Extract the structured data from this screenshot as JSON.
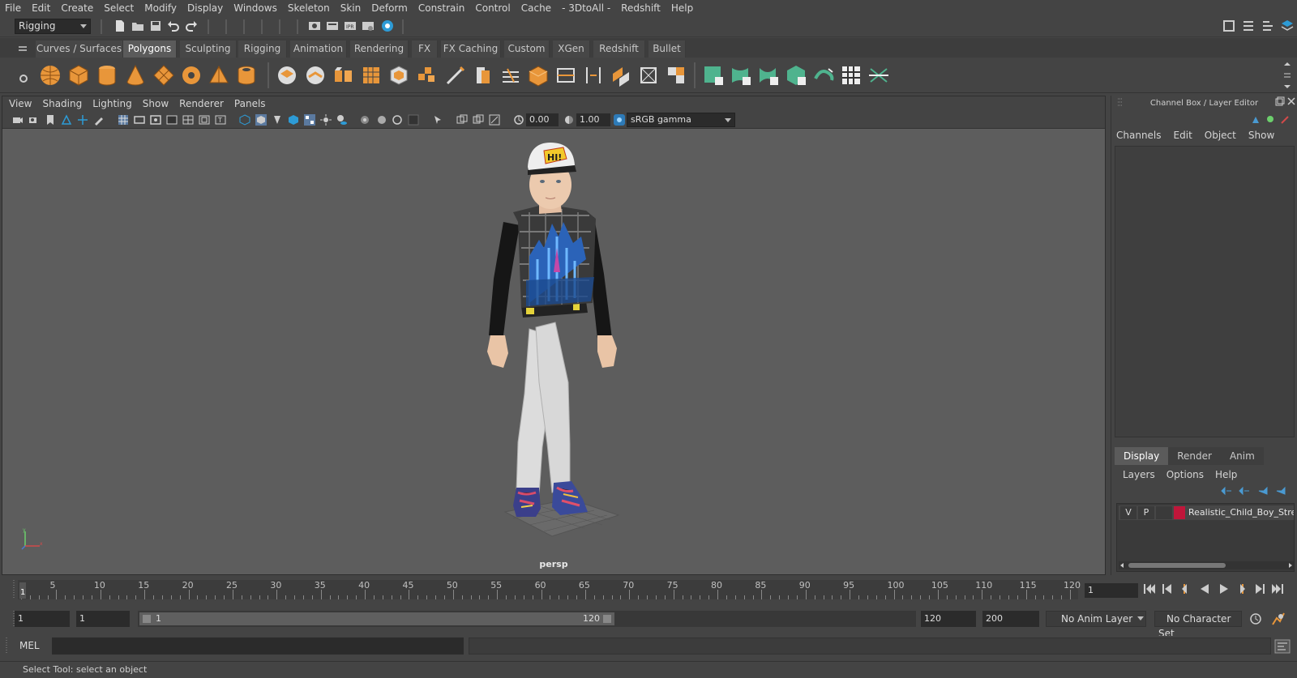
{
  "menubar": [
    "File",
    "Edit",
    "Create",
    "Select",
    "Modify",
    "Display",
    "Windows",
    "Skeleton",
    "Skin",
    "Deform",
    "Constrain",
    "Control",
    "Cache",
    "- 3DtoAll -",
    "Redshift",
    "Help"
  ],
  "status_line": {
    "mode": "Rigging"
  },
  "shelf_tabs": [
    "Curves / Surfaces",
    "Polygons",
    "Sculpting",
    "Rigging",
    "Animation",
    "Rendering",
    "FX",
    "FX Caching",
    "Custom",
    "XGen",
    "Redshift",
    "Bullet"
  ],
  "shelf_active": "Polygons",
  "viewport": {
    "menu": [
      "View",
      "Shading",
      "Lighting",
      "Show",
      "Renderer",
      "Panels"
    ],
    "exposure": "0.00",
    "gamma": "1.00",
    "color_space": "sRGB gamma",
    "camera_label": "persp"
  },
  "channel_box": {
    "title": "Channel Box / Layer Editor",
    "menu": [
      "Channels",
      "Edit",
      "Object",
      "Show"
    ],
    "layer_tabs": [
      "Display",
      "Render",
      "Anim"
    ],
    "layer_tab_active": "Display",
    "layer_menu": [
      "Layers",
      "Options",
      "Help"
    ],
    "layer": {
      "v": "V",
      "p": "P",
      "name": "Realistic_Child_Boy_Stree",
      "color": "#c0163a"
    }
  },
  "timeline": {
    "ticks": [
      5,
      10,
      15,
      20,
      25,
      30,
      35,
      40,
      45,
      50,
      55,
      60,
      65,
      70,
      75,
      80,
      85,
      90,
      95,
      100,
      105,
      110,
      115,
      120
    ],
    "start_marker": "1",
    "current_frame": "1"
  },
  "range": {
    "start": "1",
    "playback_start": "1",
    "slider_start": "1",
    "slider_end": "120",
    "playback_end": "120",
    "end": "200",
    "anim_layer": "No Anim Layer",
    "character_set": "No Character Set"
  },
  "command_line": {
    "label": "MEL"
  },
  "help_line": {
    "text": "Select Tool: select an object"
  },
  "colors": {
    "accent_teal": "#4fb38e",
    "orange_poly": "#e8963a",
    "layer_red": "#c0163a"
  }
}
